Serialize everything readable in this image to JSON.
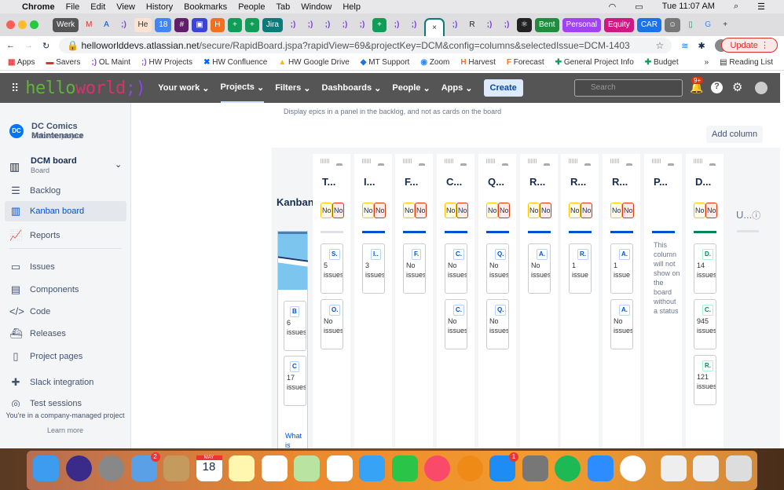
{
  "menubar": {
    "items": [
      "Chrome",
      "File",
      "Edit",
      "View",
      "History",
      "Bookmarks",
      "People",
      "Tab",
      "Window",
      "Help"
    ],
    "clock": "Tue 11:07 AM"
  },
  "tabs": [
    {
      "label": "Werk",
      "color": "#555"
    },
    {
      "label": "M",
      "color": "transparent",
      "text": "#d33"
    },
    {
      "label": "A",
      "color": "transparent",
      "text": "#0052cc"
    },
    {
      "label": ";)",
      "plain": true
    },
    {
      "label": "He",
      "color": "#fde3d2",
      "text": "#333"
    },
    {
      "label": "18",
      "color": "#4285f4"
    },
    {
      "label": "#",
      "color": "#611f69"
    },
    {
      "label": "▣",
      "color": "#3b44d6"
    },
    {
      "label": "H",
      "color": "#f37021"
    },
    {
      "label": "+",
      "color": "#0f9d58"
    },
    {
      "label": "+",
      "color": "#0f9d58"
    },
    {
      "label": "Jira",
      "color": "#0b7a7a"
    },
    {
      "label": ";)",
      "plain": true
    },
    {
      "label": ";)",
      "plain": true
    },
    {
      "label": ";)",
      "plain": true
    },
    {
      "label": ";)",
      "plain": true
    },
    {
      "label": ";)",
      "plain": true
    },
    {
      "label": "+",
      "color": "#0f9d58"
    },
    {
      "label": ";)",
      "plain": true
    },
    {
      "label": ";)",
      "plain": true
    },
    {
      "label": "×",
      "active": true
    },
    {
      "label": ";)",
      "plain": true
    },
    {
      "label": "R",
      "color": "transparent",
      "text": "#222"
    },
    {
      "label": ";)",
      "plain": true
    },
    {
      "label": ";)",
      "plain": true
    },
    {
      "label": "⚛",
      "color": "#222"
    },
    {
      "label": "Bent",
      "color": "#1e8e3e"
    },
    {
      "label": "Personal",
      "color": "#a142f4"
    },
    {
      "label": "Equity",
      "color": "#d01884"
    },
    {
      "label": "CAR",
      "color": "#1a73e8"
    },
    {
      "label": "☺",
      "color": "#777"
    },
    {
      "label": "▯",
      "color": "transparent",
      "text": "#0f9d58"
    },
    {
      "label": "G",
      "color": "transparent",
      "text": "#4285f4"
    },
    {
      "label": "+",
      "color": "transparent",
      "text": "#333"
    }
  ],
  "address": {
    "host": "helloworlddevs.atlassian.net",
    "path": "/secure/RapidBoard.jspa?rapidView=69&projectKey=DCM&config=columns&selectedIssue=DCM-1403",
    "update": "Update"
  },
  "bookmarks": [
    "Apps",
    "Savers",
    "OL Maint",
    "HW Projects",
    "HW Confluence",
    "HW Google Drive",
    "MT Support",
    "Zoom",
    "Harvest",
    "Forecast",
    "General Project Info",
    "Budget"
  ],
  "reading_list": "Reading List",
  "jira": {
    "logo": "helloworld;)",
    "nav": [
      "Your work",
      "Projects",
      "Filters",
      "Dashboards",
      "People",
      "Apps"
    ],
    "create": "Create",
    "search_placeholder": "Search",
    "notif_count": "9+"
  },
  "sidebar": {
    "project": "DC Comics Maintenance",
    "project_type": "Software project",
    "board": "DCM board",
    "board_sub": "Board",
    "items": [
      "Backlog",
      "Kanban board",
      "Reports",
      "Issues",
      "Components",
      "Code",
      "Releases",
      "Project pages",
      "Slack integration",
      "Test sessions"
    ],
    "footer": "You're in a company-managed project",
    "learn_more": "Learn more"
  },
  "main": {
    "epic_hint": "Display epics in a panel in the backlog, and not as cards on the board",
    "add_column": "Add column",
    "backlog_title": "Kanban backlog",
    "backlog_cards": [
      {
        "key": "B",
        "text": "6 issues"
      },
      {
        "key": "C",
        "text": "17 issues"
      }
    ],
    "backlog_link": "What is"
  },
  "columns": [
    {
      "title": "T...",
      "bar": "#dfe1e6",
      "cards": [
        {
          "key": "S.",
          "text": "5 issues"
        },
        {
          "key": "O.",
          "text": "No issues"
        }
      ]
    },
    {
      "title": "I...",
      "bar": "#0052cc",
      "cards": [
        {
          "key": "I..",
          "text": "3 issues"
        }
      ]
    },
    {
      "title": "F...",
      "bar": "#0052cc",
      "cards": [
        {
          "key": "F.",
          "text": "No issues"
        }
      ]
    },
    {
      "title": "C...",
      "bar": "#0052cc",
      "cards": [
        {
          "key": "C.",
          "text": "No issues"
        },
        {
          "key": "C.",
          "text": "No issues"
        }
      ]
    },
    {
      "title": "Q...",
      "bar": "#0052cc",
      "cards": [
        {
          "key": "Q.",
          "text": "No issues"
        },
        {
          "key": "Q.",
          "text": "No issues"
        }
      ]
    },
    {
      "title": "R...",
      "bar": "#0052cc",
      "cards": [
        {
          "key": "A.",
          "text": "No issues"
        }
      ]
    },
    {
      "title": "R...",
      "bar": "#0052cc",
      "cards": [
        {
          "key": "R.",
          "text": "1 issue"
        }
      ]
    },
    {
      "title": "R...",
      "bar": "#0052cc",
      "cards": [
        {
          "key": "A.",
          "text": "1 issue"
        },
        {
          "key": "A.",
          "text": "No issues"
        }
      ]
    },
    {
      "title": "P...",
      "bar": "#0052cc",
      "nobadges": true,
      "note": "This column will not show on the board without a status",
      "cards": []
    },
    {
      "title": "D...",
      "bar": "#00875a",
      "green": true,
      "cards": [
        {
          "key": "D.",
          "text": "14 issues"
        },
        {
          "key": "C.",
          "text": "945 issues"
        },
        {
          "key": "R.",
          "text": "121 issues"
        }
      ]
    }
  ],
  "badge_text": "No",
  "unmapped": "U...",
  "dock": {
    "mail_badge": "2",
    "appstore_badge": "1",
    "calendar_month": "MAY",
    "calendar_day": "18"
  }
}
